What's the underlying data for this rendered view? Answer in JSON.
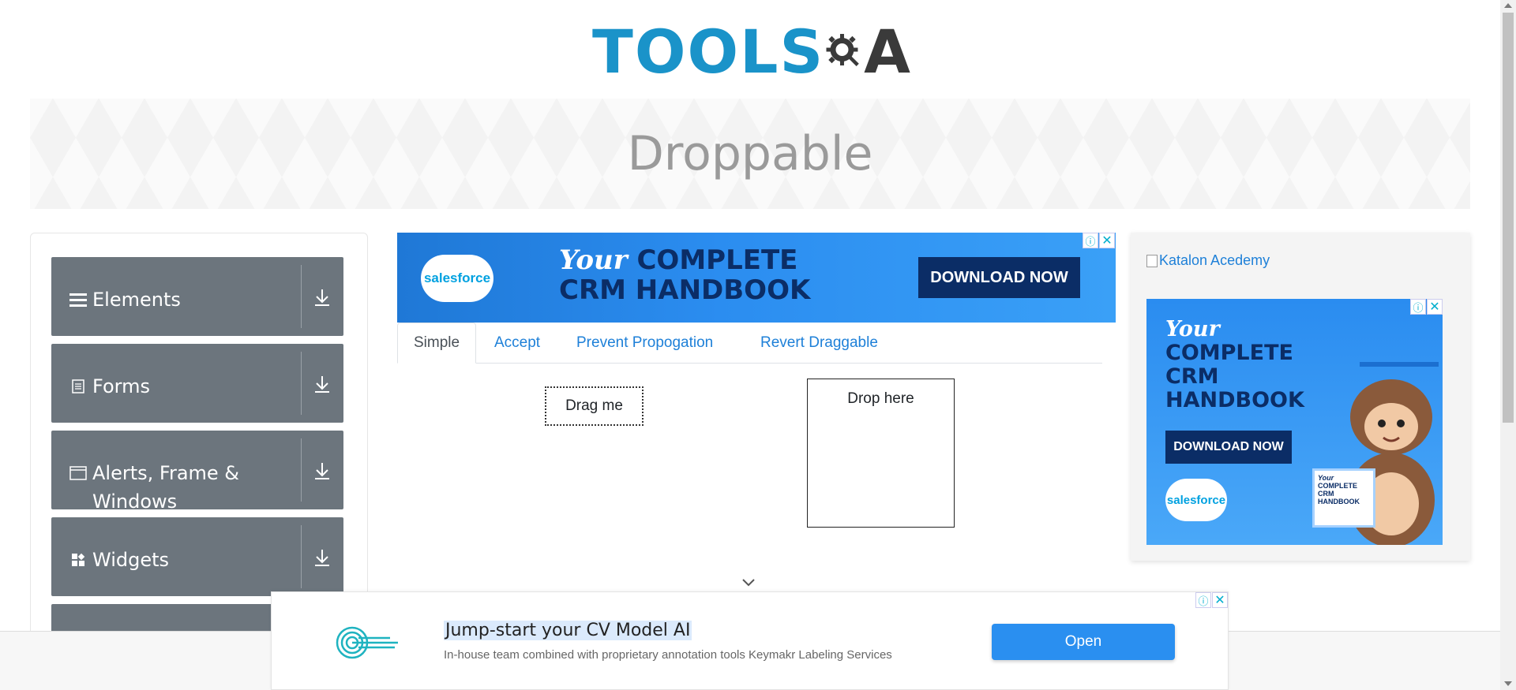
{
  "header": {
    "logo_tools": "TOOLS",
    "logo_a": "A",
    "brand_color": "#1a93c9"
  },
  "banner": {
    "title": "Droppable"
  },
  "sidebar": {
    "groups": [
      {
        "label": "Elements",
        "icon": "hamburger-icon"
      },
      {
        "label": "Forms",
        "icon": "document-icon"
      },
      {
        "label": "Alerts, Frame & Windows",
        "icon": "window-icon"
      },
      {
        "label": "Widgets",
        "icon": "widgets-icon"
      }
    ],
    "group_color": "#6c757d"
  },
  "ad_top": {
    "brand": "salesforce",
    "headline_italic": "Your",
    "headline_1": "COMPLETE",
    "headline_2": "CRM HANDBOOK",
    "cta": "DOWNLOAD NOW"
  },
  "tabs": [
    {
      "label": "Simple",
      "active": true
    },
    {
      "label": "Accept",
      "active": false
    },
    {
      "label": "Prevent Propogation",
      "active": false
    },
    {
      "label": "Revert Draggable",
      "active": false
    }
  ],
  "demo": {
    "drag_label": "Drag me",
    "drop_label": "Drop here"
  },
  "right_ad": {
    "broken_image_alt": "Katalon Acedemy",
    "headline_italic": "Your",
    "headline_lines": [
      "COMPLETE",
      "CRM",
      "HANDBOOK"
    ],
    "cta": "DOWNLOAD NOW",
    "brand": "salesforce",
    "book_text_italic": "Your",
    "book_text": "COMPLETE CRM HANDBOOK"
  },
  "bottom_ad": {
    "title": "Jump-start your CV Model AI",
    "subtitle": "In-house team combined with proprietary annotation tools Keymakr Labeling Services",
    "button": "Open"
  },
  "ad_badges": {
    "info": "ⓘ",
    "close": "✕"
  }
}
